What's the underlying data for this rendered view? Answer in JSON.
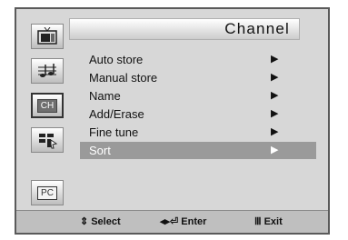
{
  "title": "Channel",
  "menu_items": [
    {
      "label": "Auto store",
      "arrow": "▶"
    },
    {
      "label": "Manual store",
      "arrow": "▶"
    },
    {
      "label": "Name",
      "arrow": "▶"
    },
    {
      "label": "Add/Erase",
      "arrow": "▶"
    },
    {
      "label": "Fine tune",
      "arrow": "▶"
    },
    {
      "label": "Sort",
      "arrow": "▶"
    }
  ],
  "side_icons": [
    {
      "name": "picture-icon"
    },
    {
      "name": "sound-icon"
    },
    {
      "name": "channel-icon",
      "text": "CH"
    },
    {
      "name": "setup-icon"
    },
    {
      "name": "pc-icon",
      "text": "PC"
    }
  ],
  "help": {
    "select_icon": "⇕",
    "select_label": "Select",
    "enter_icon": "◂▸⏎",
    "enter_label": "Enter",
    "exit_icon": "Ⅲ",
    "exit_label": "Exit"
  },
  "highlight_index": 5
}
